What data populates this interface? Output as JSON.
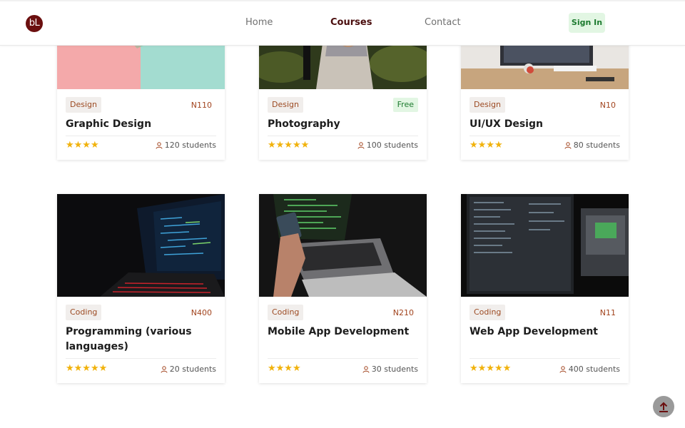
{
  "header": {
    "logo_text": "bL",
    "nav": [
      {
        "label": "Home",
        "active": false
      },
      {
        "label": "Courses",
        "active": true
      },
      {
        "label": "Contact",
        "active": false
      }
    ],
    "signin_label": "Sign In"
  },
  "colors": {
    "brand": "#6b0f0f",
    "nav_active": "#4a0d0d",
    "tag_text": "#9c4a22",
    "price_text": "#a2441e",
    "free_bg": "#e2f6e3",
    "free_text": "#1c7a2e",
    "star": "#f1b20c"
  },
  "courses": [
    {
      "category": "Design",
      "price": "N110",
      "title": "Graphic Design",
      "rating": 4,
      "students": "120 students",
      "image": "pink-mint-desk-photo"
    },
    {
      "category": "Design",
      "price": "Free",
      "title": "Photography",
      "rating": 5,
      "students": "100 students",
      "image": "person-with-camera-photo"
    },
    {
      "category": "Design",
      "price": "N10",
      "title": "UI/UX Design",
      "rating": 4,
      "students": "80 students",
      "image": "desk-monitor-keyboard-photo"
    },
    {
      "category": "Coding",
      "price": "N400",
      "title": "Programming (various languages)",
      "rating": 5,
      "students": "20 students",
      "image": "laptop-code-dark-photo"
    },
    {
      "category": "Coding",
      "price": "N210",
      "title": "Mobile App Development",
      "rating": 4,
      "students": "30 students",
      "image": "phone-over-laptop-photo"
    },
    {
      "category": "Coding",
      "price": "N11",
      "title": "Web App Development",
      "rating": 5,
      "students": "400 students",
      "image": "dual-monitor-code-photo"
    }
  ],
  "scroll_top_icon": "arrow-up-icon"
}
